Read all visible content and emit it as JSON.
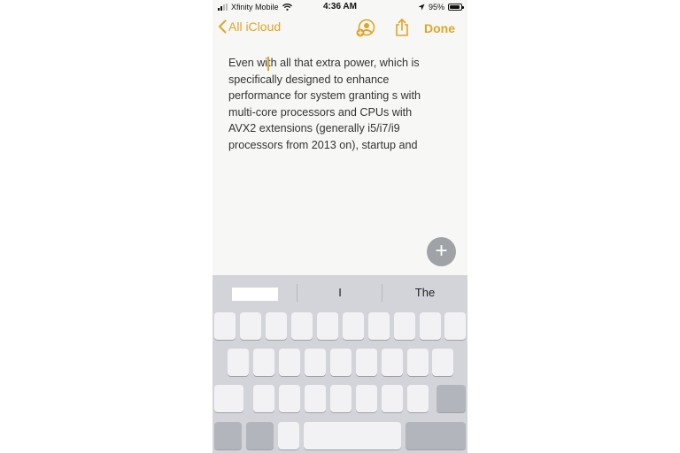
{
  "status_bar": {
    "carrier": "Xfinity Mobile",
    "time": "4:36 AM",
    "battery_percent": "95%",
    "battery_level": 0.95,
    "icons": [
      "signal-icon",
      "wifi-icon",
      "location-arrow-icon",
      "battery-icon"
    ]
  },
  "nav": {
    "back_label": "All iCloud",
    "done_label": "Done",
    "icons": [
      "chevron-left-icon",
      "add-person-icon",
      "share-icon"
    ]
  },
  "note": {
    "text": "Even with all that extra power, which is\nspecifically designed to enhance\nperformance for system granting s with\nmulti-core processors and CPUs with\nAVX2 extensions (generally i5/i7/i9\nprocessors from 2013 on), startup and"
  },
  "fab": {
    "icon": "plus-icon",
    "glyph": "+"
  },
  "keyboard": {
    "predictions": [
      "",
      "I",
      "The"
    ]
  },
  "colors": {
    "accent": "#e0a526",
    "keyboard_bg": "#d2d4d9",
    "key": "#f2f2f4",
    "key_dark": "#b2b5bc"
  }
}
